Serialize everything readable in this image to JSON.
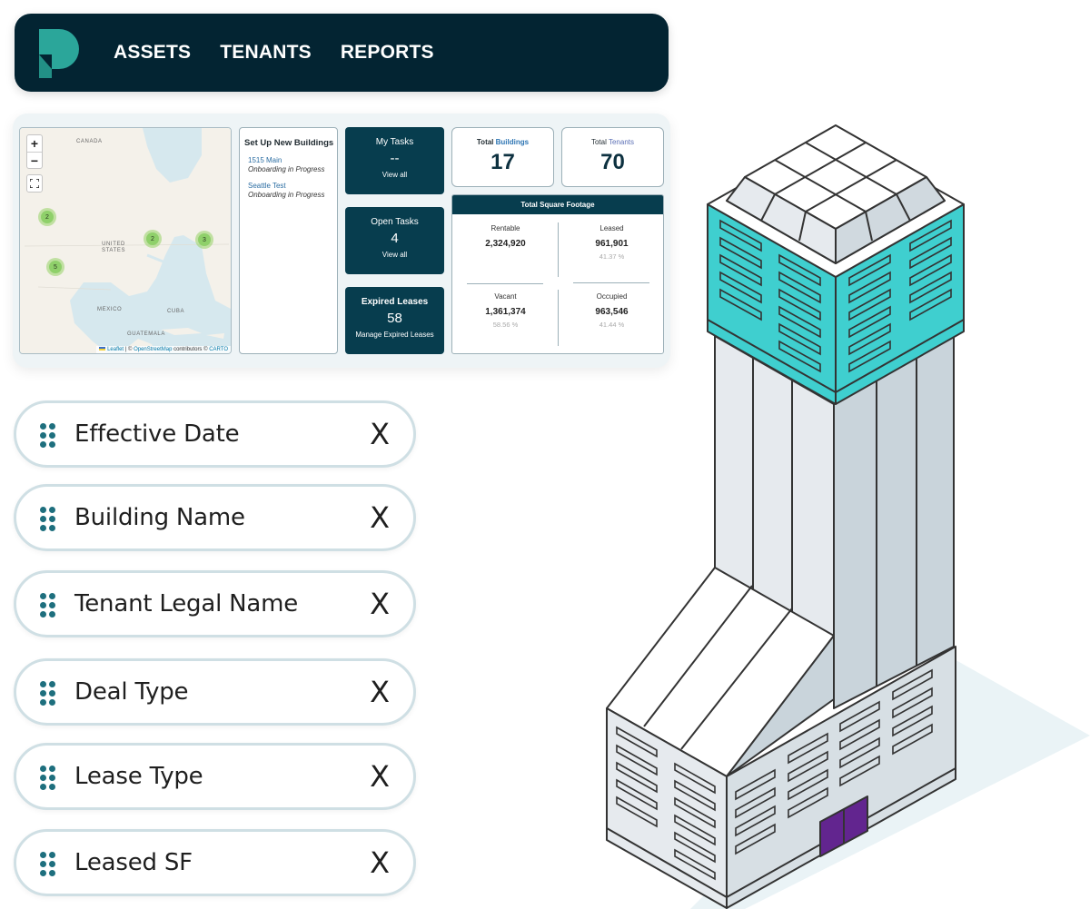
{
  "nav": {
    "logo": "pelican-p-logo",
    "links": [
      "ASSETS",
      "TENANTS",
      "REPORTS"
    ]
  },
  "map": {
    "zoom_in": "+",
    "zoom_out": "−",
    "fullscreen": "fullscreen-icon",
    "labels": {
      "canada": "CANADA",
      "us_line1": "UNITED",
      "us_line2": "STATES",
      "mexico": "MEXICO",
      "cuba": "CUBA",
      "guatemala": "GUATEMALA"
    },
    "clusters": [
      {
        "region": "Pacific Northwest",
        "count": "2"
      },
      {
        "region": "California",
        "count": "5"
      },
      {
        "region": "Midwest",
        "count": "2"
      },
      {
        "region": "Northeast",
        "count": "3"
      }
    ],
    "attribution": {
      "leaflet": "Leaflet",
      "sep": " | © ",
      "osm": "OpenStreetMap",
      "contrib": " contributors © ",
      "carto": "CARTO"
    }
  },
  "setup": {
    "title": "Set Up New Buildings",
    "items": [
      {
        "name": "1515 Main",
        "status": "Onboarding in Progress"
      },
      {
        "name": "Seattle Test",
        "status": "Onboarding in Progress"
      }
    ]
  },
  "tasks": {
    "my_tasks": {
      "title": "My Tasks",
      "value": "--",
      "link": "View all"
    },
    "open_tasks": {
      "title": "Open Tasks",
      "value": "4",
      "link": "View all"
    },
    "expired_leases": {
      "title": "Expired Leases",
      "value": "58",
      "link": "Manage Expired Leases"
    }
  },
  "totals": {
    "buildings": {
      "prefix": "Total ",
      "label": "Buildings",
      "value": "17"
    },
    "tenants": {
      "prefix": "Total ",
      "label": "Tenants",
      "value": "70"
    }
  },
  "square_footage": {
    "title": "Total Square Footage",
    "rentable": {
      "label": "Rentable",
      "value": "2,324,920"
    },
    "leased": {
      "label": "Leased",
      "value": "961,901",
      "pct": "41.37 %"
    },
    "vacant": {
      "label": "Vacant",
      "value": "1,361,374",
      "pct": "58.56 %"
    },
    "occupied": {
      "label": "Occupied",
      "value": "963,546",
      "pct": "41.44 %"
    }
  },
  "fields": [
    {
      "label": "Effective Date",
      "remove": "X"
    },
    {
      "label": "Building Name",
      "remove": "X"
    },
    {
      "label": "Tenant Legal Name",
      "remove": "X"
    },
    {
      "label": "Deal Type",
      "remove": "X"
    },
    {
      "label": "Lease Type",
      "remove": "X"
    },
    {
      "label": "Leased SF",
      "remove": "X"
    }
  ],
  "colors": {
    "nav_bg": "#032432",
    "brand_teal": "#2ba69a",
    "card_dark": "#073d4e",
    "building_accent": "#3fcfcf",
    "door": "#62258f",
    "cluster": "#8fd06a"
  }
}
